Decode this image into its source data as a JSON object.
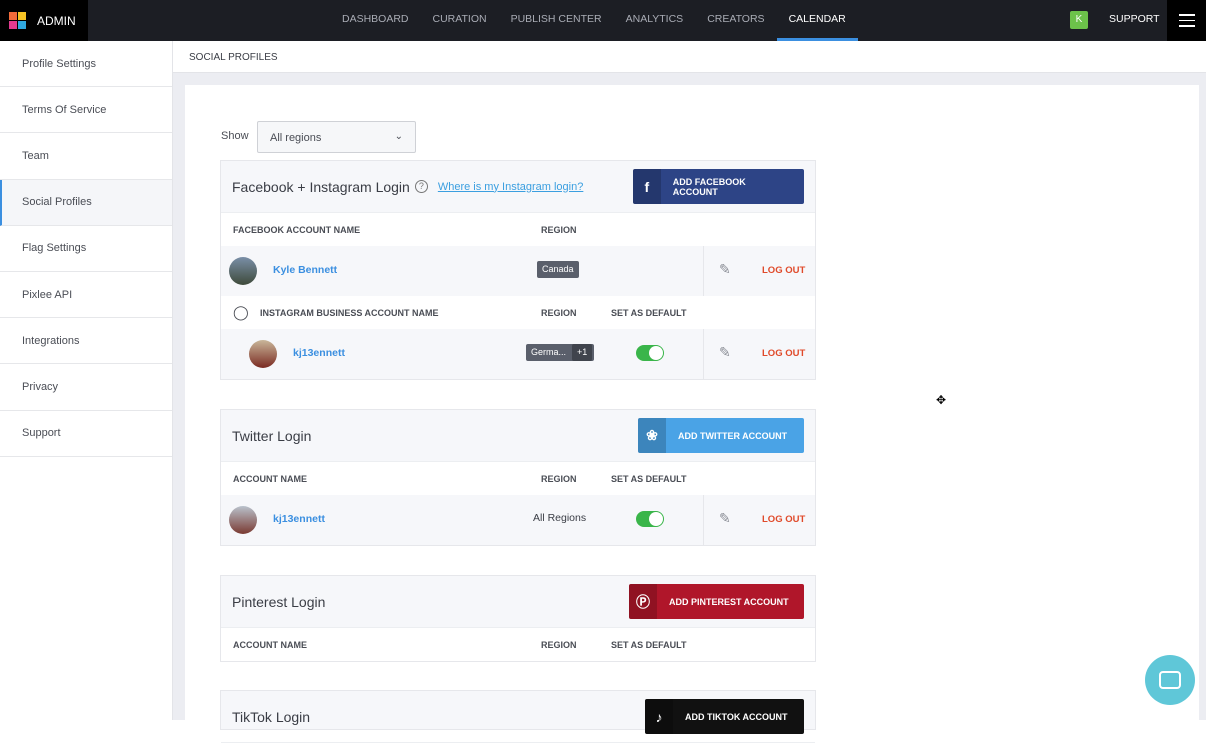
{
  "topbar": {
    "brand": "ADMIN",
    "nav": [
      "DASHBOARD",
      "CURATION",
      "PUBLISH CENTER",
      "ANALYTICS",
      "CREATORS",
      "CALENDAR"
    ],
    "active_nav": "CALENDAR",
    "user_initial": "K",
    "support": "SUPPORT",
    "accent": "#3b8fe0"
  },
  "sidebar": {
    "items": [
      "Profile Settings",
      "Terms Of Service",
      "Team",
      "Social Profiles",
      "Flag Settings",
      "Pixlee API",
      "Integrations",
      "Privacy",
      "Support"
    ],
    "active": "Social Profiles"
  },
  "breadcrumb": "SOCIAL PROFILES",
  "filter": {
    "label": "Show",
    "value": "All regions"
  },
  "facebook": {
    "title": "Facebook + Instagram Login",
    "help_link": "Where is my Instagram login?",
    "add_button": "ADD FACEBOOK ACCOUNT",
    "fb_headers": [
      "FACEBOOK ACCOUNT NAME",
      "REGION"
    ],
    "fb_row": {
      "name": "Kyle Bennett",
      "region": "Canada",
      "logout": "LOG OUT"
    },
    "ig_headers": [
      "INSTAGRAM BUSINESS ACCOUNT NAME",
      "REGION",
      "SET AS DEFAULT"
    ],
    "ig_row": {
      "name": "kj13ennett",
      "region": "Germa...",
      "region_more": "+1",
      "default": true,
      "logout": "LOG OUT"
    }
  },
  "twitter": {
    "title": "Twitter Login",
    "add_button": "ADD TWITTER ACCOUNT",
    "headers": [
      "ACCOUNT NAME",
      "REGION",
      "SET AS DEFAULT"
    ],
    "row": {
      "name": "kj13ennett",
      "region": "All Regions",
      "default": true,
      "logout": "LOG OUT"
    }
  },
  "pinterest": {
    "title": "Pinterest Login",
    "add_button": "ADD PINTEREST ACCOUNT",
    "headers": [
      "ACCOUNT NAME",
      "REGION",
      "SET AS DEFAULT"
    ]
  },
  "tiktok": {
    "title": "TikTok Login",
    "add_button": "ADD TIKTOK ACCOUNT"
  }
}
